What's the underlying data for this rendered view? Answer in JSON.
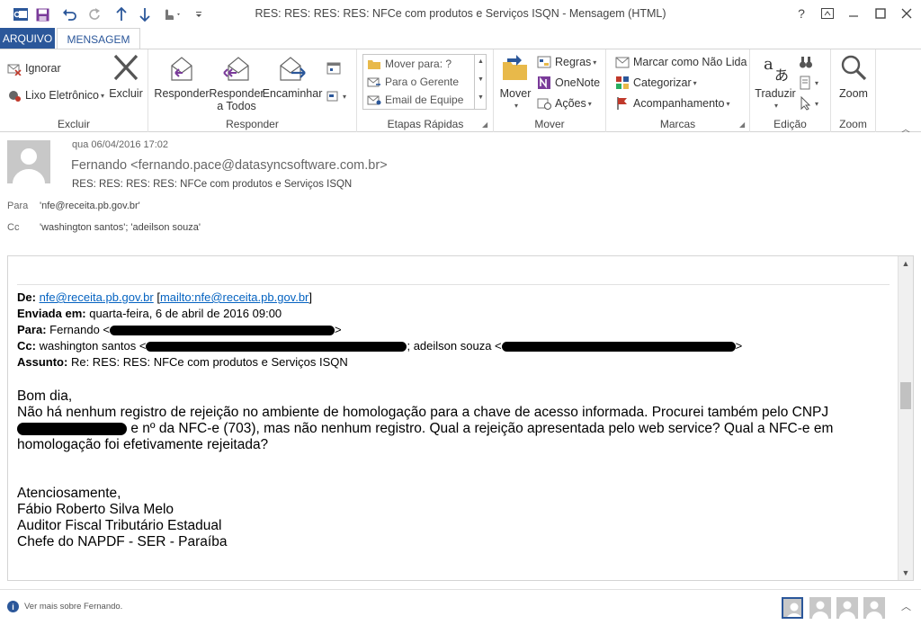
{
  "window": {
    "title": "RES: RES: RES: RES: NFCe com produtos e Serviços ISQN - Mensagem (HTML)",
    "help": "?",
    "restore": "❐",
    "minimize": "—",
    "maximize": "☐",
    "close": "✕"
  },
  "tabs": {
    "file": "ARQUIVO",
    "message": "MENSAGEM"
  },
  "ribbon": {
    "excluir_group": {
      "label": "Excluir",
      "ignore": "Ignorar",
      "junk": "Lixo Eletrônico",
      "delete": "Excluir"
    },
    "responder_group": {
      "label": "Responder",
      "reply": "Responder",
      "reply_all_1": "Responder",
      "reply_all_2": "a Todos",
      "forward": "Encaminhar"
    },
    "quick_steps": {
      "label": "Etapas Rápidas",
      "items": [
        "Mover para: ?",
        "Para o Gerente",
        "Email de Equipe"
      ]
    },
    "mover_group": {
      "label": "Mover",
      "move": "Mover",
      "rules": "Regras",
      "onenote": "OneNote",
      "actions": "Ações"
    },
    "marcas_group": {
      "label": "Marcas",
      "mark_unread": "Marcar como Não Lida",
      "categorize": "Categorizar",
      "followup": "Acompanhamento"
    },
    "edicao_group": {
      "label": "Edição",
      "translate": "Traduzir"
    },
    "zoom_group": {
      "label": "Zoom",
      "zoom": "Zoom"
    }
  },
  "message": {
    "date": "qua 06/04/2016 17:02",
    "sender": "Fernando <fernando.pace@datasyncsoftware.com.br>",
    "subject": "RES: RES: RES: RES: NFCe com produtos e Serviços ISQN",
    "to_label": "Para",
    "to_value": "'nfe@receita.pb.gov.br'",
    "cc_label": "Cc",
    "cc_value": "'washington santos'; 'adeilson souza'"
  },
  "body": {
    "de_label": "De:",
    "de_link1": "nfe@receita.pb.gov.br",
    "de_link2": "mailto:nfe@receita.pb.gov.br",
    "enviada_label": "Enviada em:",
    "enviada_value": "quarta-feira, 6 de abril de 2016 09:00",
    "para_label": "Para:",
    "para_value": "Fernando <",
    "cc_label": "Cc:",
    "cc_value1": "washington santos <",
    "cc_value2": "; adeilson souza <",
    "assunto_label": "Assunto:",
    "assunto_value": "Re: RES: RES: NFCe com produtos e Serviços ISQN",
    "greeting": "Bom dia,",
    "para1_line1": " Não há nenhum registro de rejeição no ambiente de homologação para a chave de acesso informada. Procurei também pelo CNPJ",
    "para1_line2": "e nº da NFC-e (703), mas não nenhum registro. Qual a rejeição apresentada pelo web service? Qual a NFC-e em",
    "para1_line3": "homologação foi efetivamente rejeitada?",
    "sig1": "Atenciosamente,",
    "sig2": "Fábio Roberto Silva Melo",
    "sig3": "Auditor Fiscal Tributário Estadual",
    "sig4": "Chefe do NAPDF - SER - Paraíba"
  },
  "status": {
    "info": "Ver mais sobre Fernando."
  },
  "colors": {
    "accent": "#2b579a",
    "link": "#0563c1"
  }
}
